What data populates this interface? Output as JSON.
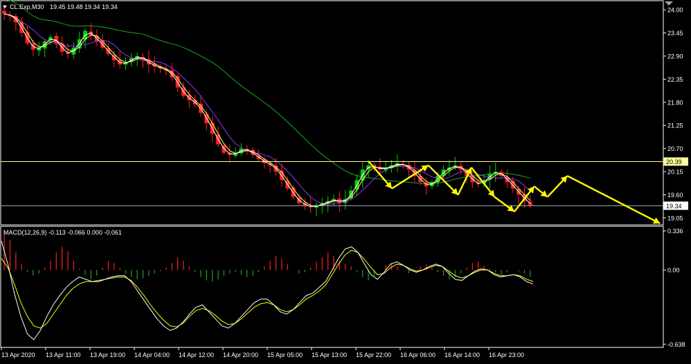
{
  "header": {
    "symbol": "CL.Exp,M30",
    "ohlc": "19.45 19.48 19.34 19.34"
  },
  "colors": {
    "background": "#000000",
    "bull": "#00d100",
    "bear": "#ff2020",
    "ma_fast": "#ffffff",
    "ma_mid": "#ffff66",
    "ma_slow": "#9b30ff",
    "ma_long": "#1fa51f",
    "level_line": "#ffff99",
    "price_line": "#b0b0c0",
    "arrow": "#ffff00",
    "macd_line": "#ffffff",
    "signal_line": "#ffff00",
    "hist_pos": "#ff2020",
    "hist_neg": "#1fa51f",
    "axis_text": "#ffffff"
  },
  "chart_data": [
    {
      "type": "candlestick",
      "symbol": "CL.Exp",
      "timeframe": "M30",
      "ylim": [
        18.9,
        24.2
      ],
      "y_ticks": [
        24.0,
        23.45,
        22.9,
        22.35,
        21.8,
        21.25,
        20.7,
        20.15,
        19.6,
        19.05
      ],
      "x_ticks": [
        "13 Apr 2020",
        "13 Apr 11:00",
        "13 Apr 19:00",
        "14 Apr 04:00",
        "14 Apr 12:00",
        "14 Apr 20:00",
        "15 Apr 05:00",
        "15 Apr 13:00",
        "15 Apr 22:00",
        "16 Apr 06:00",
        "16 Apr 14:00",
        "16 Apr 23:00"
      ],
      "close_path": [
        23.9,
        23.85,
        23.7,
        23.45,
        23.2,
        23.05,
        23.1,
        23.25,
        23.35,
        23.2,
        23.0,
        22.95,
        23.1,
        23.3,
        23.5,
        23.4,
        23.25,
        23.1,
        22.95,
        22.8,
        22.7,
        22.75,
        22.85,
        22.9,
        22.8,
        22.7,
        22.65,
        22.6,
        22.55,
        22.4,
        22.15,
        21.95,
        21.85,
        21.75,
        21.55,
        21.3,
        21.05,
        20.8,
        20.6,
        20.55,
        20.6,
        20.7,
        20.65,
        20.55,
        20.45,
        20.35,
        20.3,
        20.15,
        19.95,
        19.75,
        19.55,
        19.4,
        19.35,
        19.3,
        19.35,
        19.4,
        19.45,
        19.5,
        19.4,
        19.5,
        19.7,
        19.95,
        20.2,
        20.3,
        20.25,
        20.2,
        20.25,
        20.3,
        20.35,
        20.3,
        20.2,
        20.05,
        19.9,
        19.8,
        19.9,
        20.05,
        20.2,
        20.25,
        20.3,
        20.2,
        20.05,
        19.9,
        19.85,
        19.95,
        20.1,
        20.15,
        20.05,
        19.9,
        19.75,
        19.6,
        19.45,
        19.34
      ],
      "horizontal_levels": [
        20.39,
        19.34
      ],
      "price_labels": [
        "20.39",
        "19.34"
      ],
      "arrow_path": [
        [
          55.5,
          20.39
        ],
        [
          59.0,
          19.75
        ],
        [
          64.5,
          20.3
        ],
        [
          69.0,
          19.6
        ],
        [
          71.0,
          20.25
        ],
        [
          74.5,
          19.55
        ],
        [
          77.5,
          19.2
        ],
        [
          80.5,
          19.8
        ],
        [
          82.5,
          19.55
        ],
        [
          85.5,
          20.05
        ],
        [
          99.5,
          18.92
        ]
      ]
    },
    {
      "type": "bar",
      "label": "MACD(12,26,9) -0.113 -0.066 0.000 -0.061",
      "ylim": [
        -0.66,
        0.37
      ],
      "y_ticks": [
        0.336,
        0.0,
        -0.638
      ],
      "histogram": [
        0.33,
        0.26,
        0.15,
        0.05,
        -0.02,
        -0.05,
        -0.03,
        0.02,
        0.08,
        0.15,
        0.2,
        0.16,
        0.08,
        0.01,
        -0.04,
        -0.08,
        -0.05,
        0.02,
        0.08,
        0.06,
        0.02,
        -0.03,
        -0.06,
        -0.08,
        -0.07,
        -0.05,
        -0.03,
        -0.01,
        0.02,
        0.06,
        0.11,
        0.08,
        0.03,
        -0.02,
        -0.06,
        -0.09,
        -0.1,
        -0.08,
        -0.05,
        -0.03,
        -0.02,
        -0.04,
        -0.06,
        -0.05,
        -0.02,
        0.03,
        0.08,
        0.12,
        0.1,
        0.05,
        0.0,
        -0.03,
        -0.02,
        0.02,
        0.07,
        0.11,
        0.15,
        0.12,
        0.08,
        0.05,
        0.03,
        -0.02,
        -0.06,
        -0.09,
        -0.05,
        0.0,
        0.04,
        0.06,
        0.03,
        0.0,
        -0.03,
        -0.01,
        0.03,
        0.05,
        0.02,
        -0.02,
        -0.05,
        -0.08,
        -0.06,
        -0.03,
        0.02,
        0.06,
        0.07,
        0.04,
        0.01,
        -0.02,
        -0.04,
        -0.02,
        0.0,
        -0.01,
        -0.03,
        -0.06
      ],
      "macd": [
        0.25,
        0.05,
        -0.2,
        -0.4,
        -0.55,
        -0.6,
        -0.52,
        -0.4,
        -0.3,
        -0.22,
        -0.15,
        -0.1,
        -0.06,
        -0.08,
        -0.1,
        -0.1,
        -0.08,
        -0.06,
        -0.05,
        -0.05,
        -0.1,
        -0.18,
        -0.26,
        -0.34,
        -0.42,
        -0.48,
        -0.52,
        -0.5,
        -0.45,
        -0.38,
        -0.32,
        -0.3,
        -0.36,
        -0.42,
        -0.48,
        -0.5,
        -0.46,
        -0.4,
        -0.34,
        -0.28,
        -0.25,
        -0.25,
        -0.3,
        -0.36,
        -0.38,
        -0.34,
        -0.28,
        -0.22,
        -0.2,
        -0.15,
        -0.1,
        0.0,
        0.1,
        0.18,
        0.2,
        0.15,
        0.05,
        -0.04,
        -0.08,
        -0.02,
        0.05,
        0.07,
        0.04,
        0.0,
        -0.02,
        0.0,
        0.03,
        0.05,
        0.03,
        -0.03,
        -0.08,
        -0.09,
        -0.05,
        -0.01,
        0.01,
        0.0,
        -0.04,
        -0.06,
        -0.05,
        -0.04,
        -0.06,
        -0.1,
        -0.12
      ],
      "signal": [
        0.1,
        0.02,
        -0.12,
        -0.28,
        -0.4,
        -0.48,
        -0.5,
        -0.46,
        -0.38,
        -0.3,
        -0.22,
        -0.16,
        -0.12,
        -0.1,
        -0.1,
        -0.09,
        -0.08,
        -0.07,
        -0.06,
        -0.06,
        -0.09,
        -0.15,
        -0.22,
        -0.3,
        -0.37,
        -0.43,
        -0.48,
        -0.49,
        -0.46,
        -0.4,
        -0.35,
        -0.33,
        -0.35,
        -0.39,
        -0.44,
        -0.47,
        -0.46,
        -0.42,
        -0.37,
        -0.32,
        -0.29,
        -0.28,
        -0.3,
        -0.34,
        -0.36,
        -0.34,
        -0.3,
        -0.25,
        -0.22,
        -0.18,
        -0.13,
        -0.04,
        0.05,
        0.13,
        0.17,
        0.15,
        0.09,
        0.02,
        -0.04,
        -0.03,
        0.02,
        0.05,
        0.04,
        0.01,
        -0.01,
        0.0,
        0.02,
        0.04,
        0.03,
        -0.01,
        -0.05,
        -0.07,
        -0.05,
        -0.02,
        0.0,
        0.0,
        -0.03,
        -0.05,
        -0.05,
        -0.04,
        -0.05,
        -0.08,
        -0.1
      ]
    }
  ]
}
